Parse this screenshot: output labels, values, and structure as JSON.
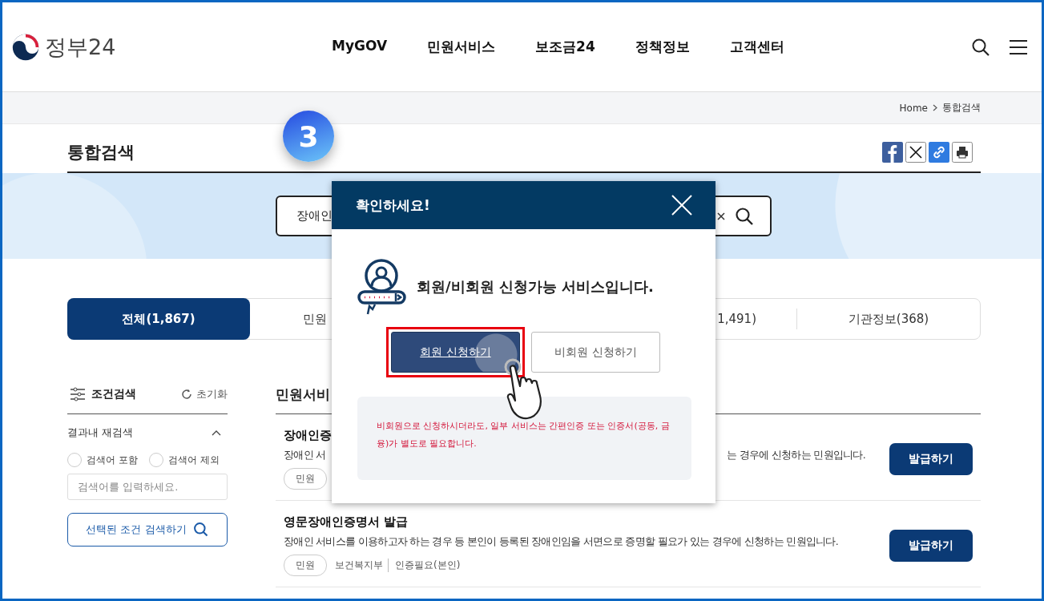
{
  "header": {
    "logo_text": "정부24",
    "nav": [
      "MyGOV",
      "민원서비스",
      "보조금24",
      "정책정보",
      "고객센터"
    ]
  },
  "breadcrumb": [
    "Home",
    "통합검색"
  ],
  "page_title": "통합검색",
  "step_badge": "3",
  "search": {
    "value": "장애인"
  },
  "tabs": [
    {
      "label": "전체(1,867)",
      "selected": true
    },
    {
      "label": "민원",
      "selected": false
    },
    {
      "label": "1,491)",
      "selected": false
    },
    {
      "label": "기관정보(368)",
      "selected": false
    }
  ],
  "filter": {
    "title": "조건검색",
    "reset": "초기화",
    "section": "결과내 재검색",
    "expanded": true,
    "options": [
      {
        "label": "검색어 포함",
        "selected": false
      },
      {
        "label": "검색어 제외",
        "selected": false
      }
    ],
    "placeholder": "검색어를 입력하세요.",
    "button": "선택된 조건 검색하기"
  },
  "results": {
    "heading": "민원서비",
    "items": [
      {
        "title": "**장애인증**",
        "desc": [
          "장애인 서",
          "는 경우에 신청하는 민원입니다."
        ],
        "tags": [
          {
            "kind": "pill",
            "text": "민원"
          }
        ],
        "button": "발급하기"
      },
      {
        "title": "영문**장애인증명서** 발급",
        "desc": [
          "장애인 서비스를 이용하고자 하는 경우 등 본인이 등록된 장애인임을 서면으로 증명할 필요가 있는 경우에 신청하는 민원입니다."
        ],
        "tags": [
          {
            "kind": "pill",
            "text": "민원"
          },
          {
            "kind": "text",
            "text": "보건복지부"
          },
          {
            "kind": "text",
            "text": "인증필요(본인)"
          }
        ],
        "button": "발급하기"
      }
    ]
  },
  "modal": {
    "title": "확인하세요!",
    "message": "회원/비회원 신청가능 서비스입니다.",
    "buttons": [
      {
        "label": "회원 신청하기",
        "kind": "primary",
        "highlighted": true
      },
      {
        "label": "비회원 신청하기",
        "kind": "secondary",
        "highlighted": false
      }
    ],
    "note": "비회원으로 신청하시더라도, 일부 서비스는 간편인증 또는 인증서(공동, 금융)가 별도로 필요합니다."
  }
}
